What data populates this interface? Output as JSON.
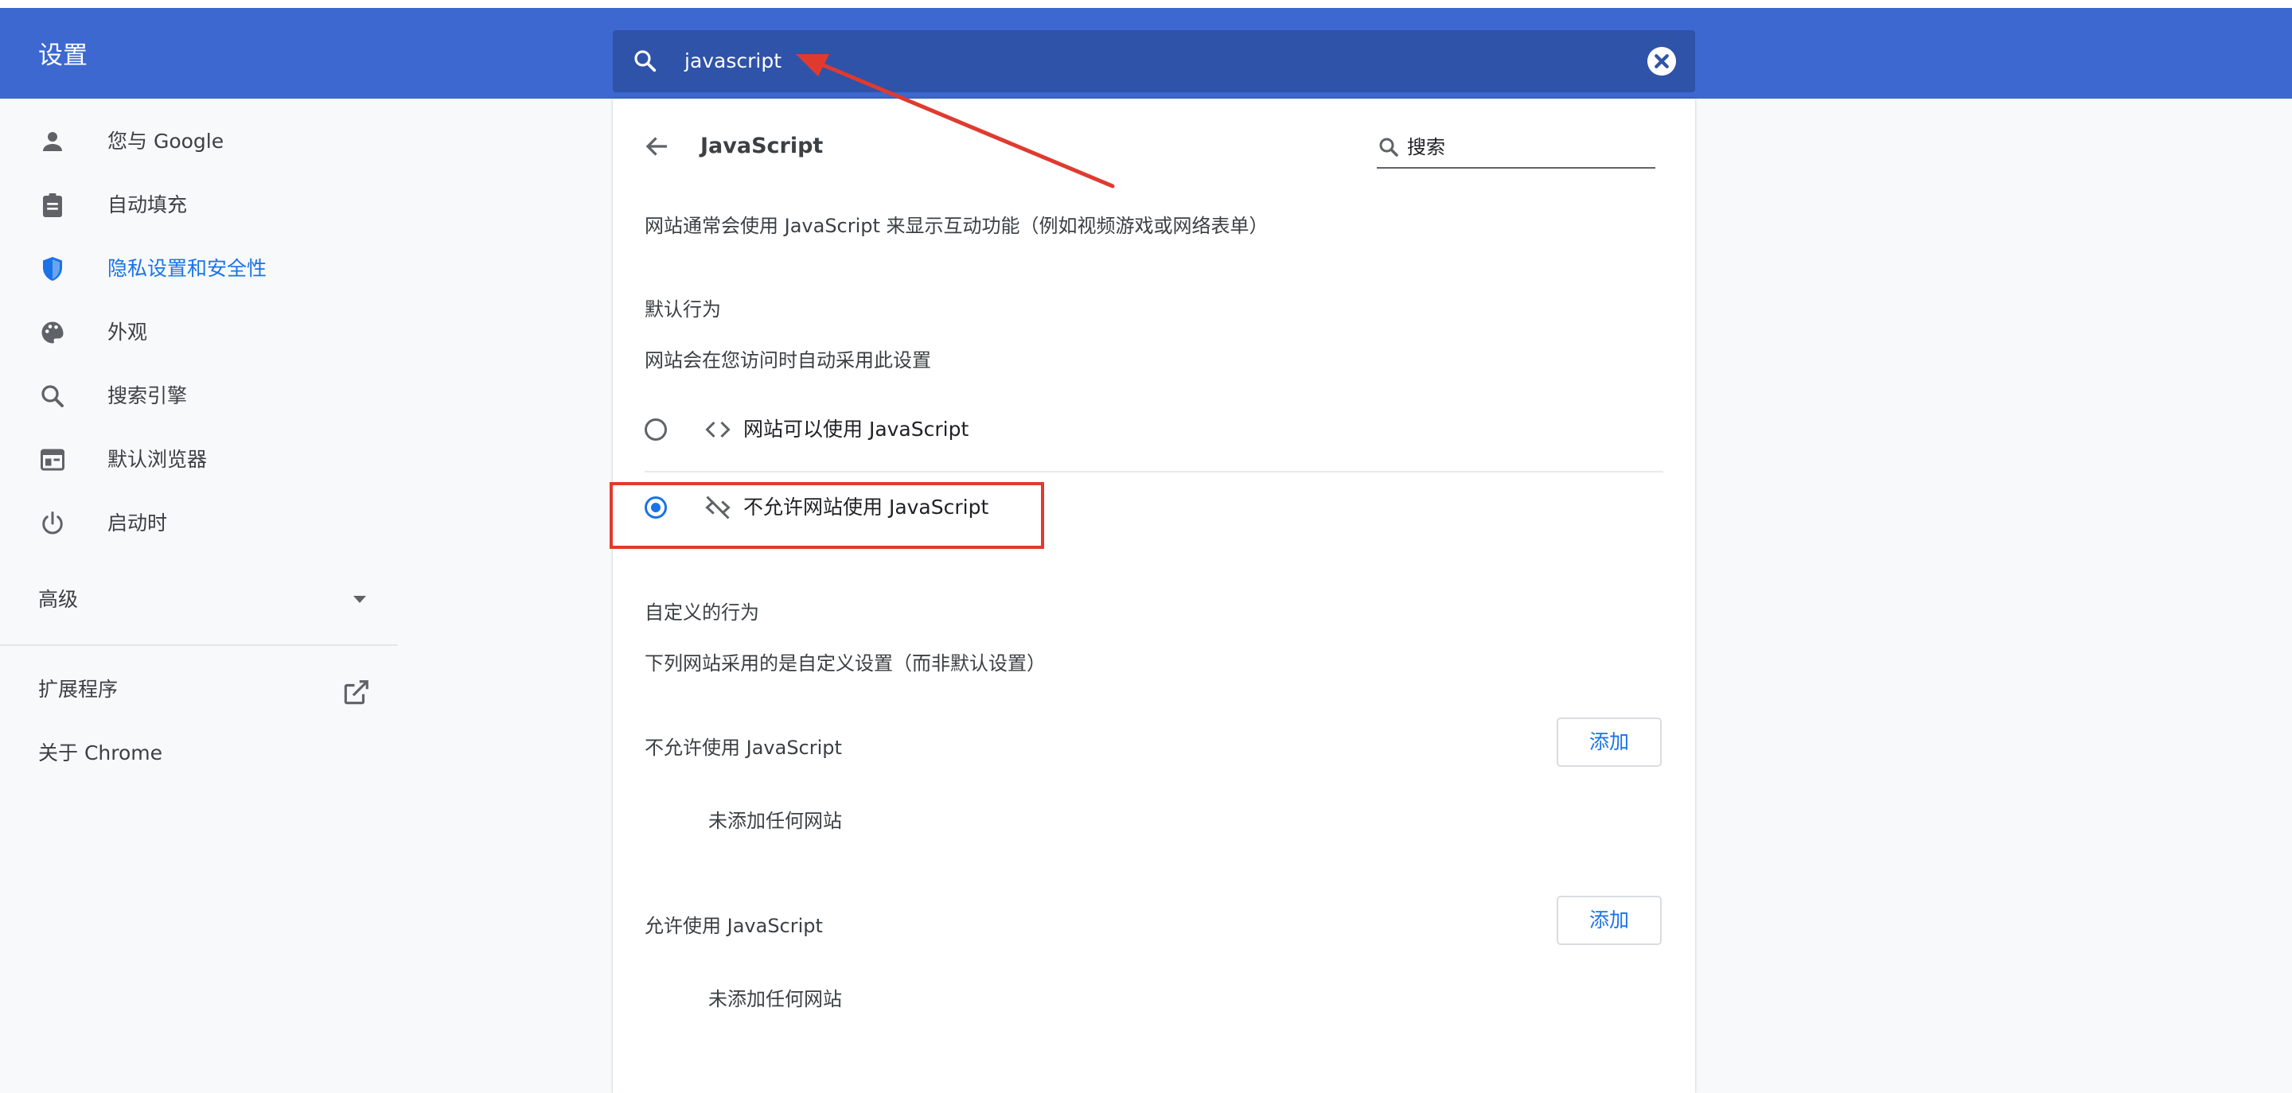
{
  "header": {
    "title": "设置",
    "search_value": "javascript"
  },
  "sidebar": {
    "items": [
      {
        "label": "您与 Google",
        "icon": "person-icon"
      },
      {
        "label": "自动填充",
        "icon": "clipboard-icon"
      },
      {
        "label": "隐私设置和安全性",
        "icon": "shield-icon",
        "active": true
      },
      {
        "label": "外观",
        "icon": "palette-icon"
      },
      {
        "label": "搜索引擎",
        "icon": "search-icon"
      },
      {
        "label": "默认浏览器",
        "icon": "browser-icon"
      },
      {
        "label": "启动时",
        "icon": "power-icon"
      }
    ],
    "advanced_label": "高级",
    "extensions_label": "扩展程序",
    "about_label": "关于 Chrome"
  },
  "main": {
    "title": "JavaScript",
    "search_placeholder": "搜索",
    "description": "网站通常会使用 JavaScript 来显示互动功能（例如视频游戏或网络表单）",
    "default_heading": "默认行为",
    "default_desc": "网站会在您访问时自动采用此设置",
    "options": [
      {
        "label": "网站可以使用 JavaScript",
        "icon": "code-icon",
        "checked": false
      },
      {
        "label": "不允许网站使用 JavaScript",
        "icon": "code-off-icon",
        "checked": true
      }
    ],
    "custom_heading": "自定义的行为",
    "custom_desc": "下列网站采用的是自定义设置（而非默认设置）",
    "blocked_label": "不允许使用 JavaScript",
    "allowed_label": "允许使用 JavaScript",
    "add_label": "添加",
    "empty_label": "未添加任何网站"
  },
  "colors": {
    "header_bg": "#3c68cf",
    "accent": "#1a73e8",
    "annotation_red": "#e03a30"
  }
}
